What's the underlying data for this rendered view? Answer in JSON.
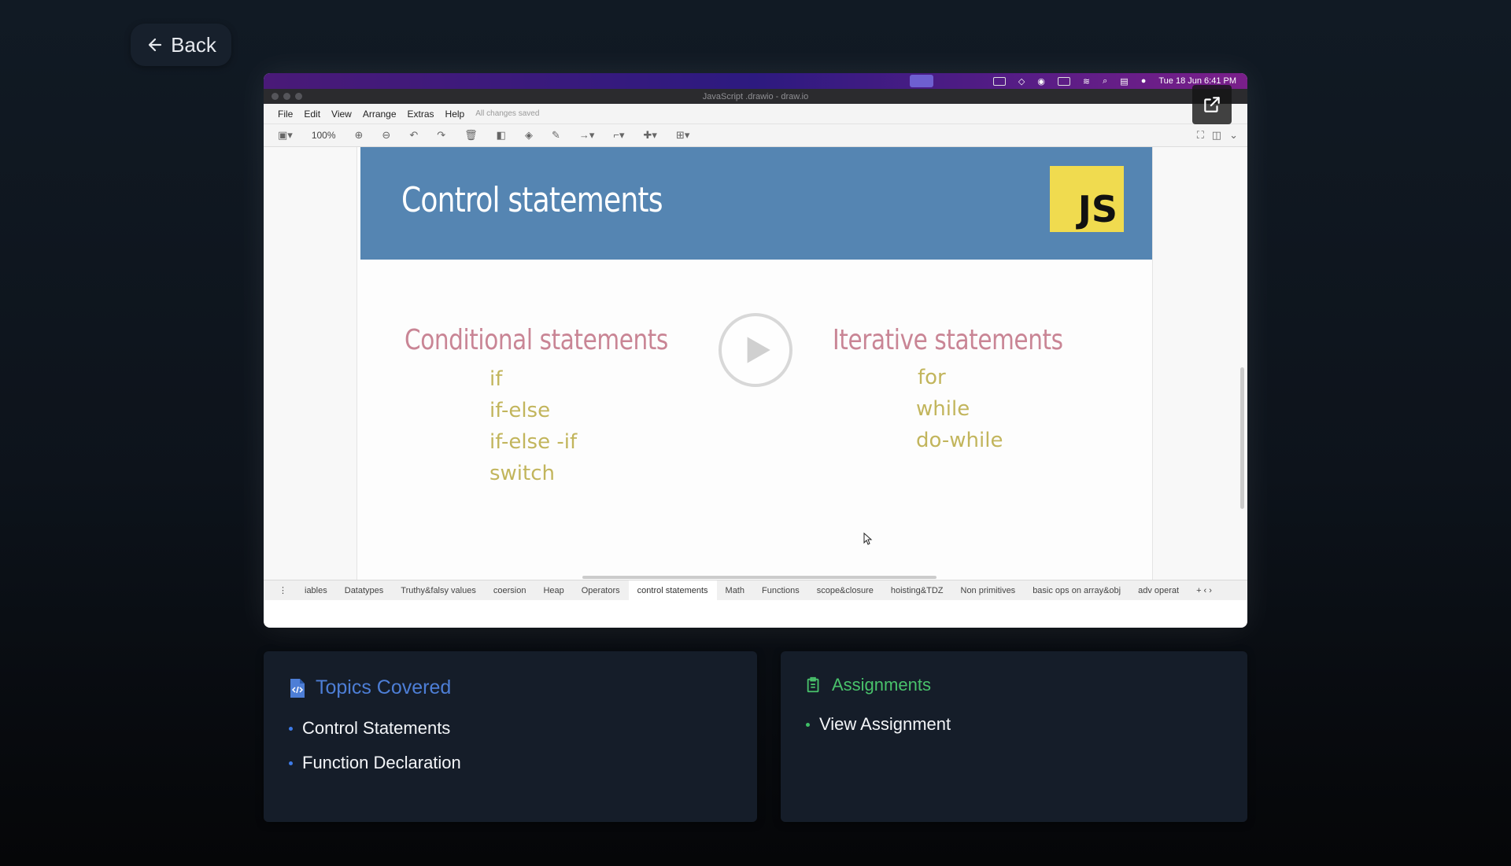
{
  "back_button": {
    "label": "Back"
  },
  "player": {
    "mac_menubar": {
      "datetime": "Tue 18 Jun 6:41 PM"
    },
    "window_title": "JavaScript .drawio - draw.io",
    "menu": [
      "File",
      "Edit",
      "View",
      "Arrange",
      "Extras",
      "Help"
    ],
    "save_status": "All changes saved",
    "zoom": "100%",
    "slide": {
      "title": "Control statements",
      "logo_text": "JS",
      "left_heading": "Conditional statements",
      "left_items": [
        "if",
        "if-else",
        "if-else -if",
        "switch"
      ],
      "right_heading": "Iterative statements",
      "right_items": [
        "for",
        "while",
        "do-while"
      ]
    },
    "sheet_tabs": [
      "iables",
      "Datatypes",
      "Truthy&falsy values",
      "coersion",
      "Heap",
      "Operators",
      "control statements",
      "Math",
      "Functions",
      "scope&closure",
      "hoisting&TDZ",
      "Non primitives",
      "basic ops on array&obj",
      "adv operat"
    ],
    "active_tab": "control statements"
  },
  "topics": {
    "title": "Topics Covered",
    "items": [
      "Control Statements",
      "Function Declaration"
    ]
  },
  "assignments": {
    "title": "Assignments",
    "items": [
      "View Assignment"
    ]
  },
  "colors": {
    "topics_accent": "#4d7ed6",
    "assignments_accent": "#49c26b",
    "slide_header": "#5585b2",
    "js_logo": "#f0db4f"
  }
}
